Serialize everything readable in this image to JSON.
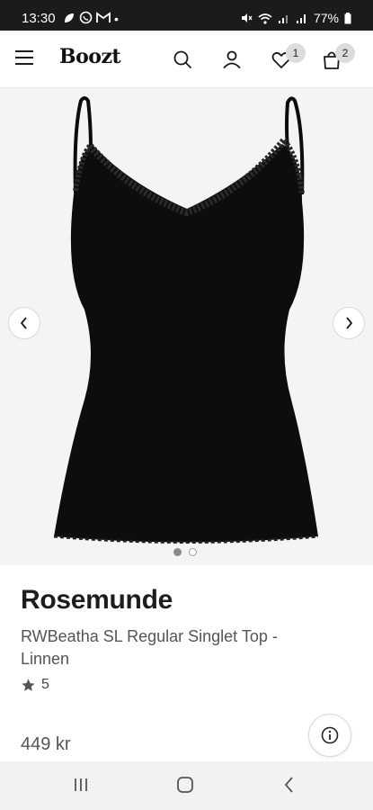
{
  "status_bar": {
    "time": "13:30",
    "dot": "•",
    "battery": "77%",
    "icons": [
      "leaf-icon",
      "whatsapp-icon",
      "gmail-icon",
      "mute-icon",
      "wifi-icon",
      "signal-icon",
      "signal-icon",
      "battery-icon"
    ]
  },
  "header": {
    "logo": "Boozt",
    "wishlist_count": "1",
    "cart_count": "2",
    "icons": [
      "menu-icon",
      "search-icon",
      "account-icon",
      "heart-icon",
      "bag-icon"
    ]
  },
  "gallery": {
    "image_alt": "Black ribbed singlet top with lace trim",
    "slide_count": 2,
    "active_slide": 1
  },
  "product": {
    "brand": "Rosemunde",
    "name": "RWBeatha SL Regular Singlet Top - Linnen",
    "rating": "5",
    "price": "449 kr"
  },
  "colors": {
    "status_bar": "#1b1b1b",
    "gallery_bg": "#f4f4f4",
    "text_dark": "#1d1d1d",
    "text_muted": "#555555",
    "navbar_bg": "#f2f2f2"
  }
}
